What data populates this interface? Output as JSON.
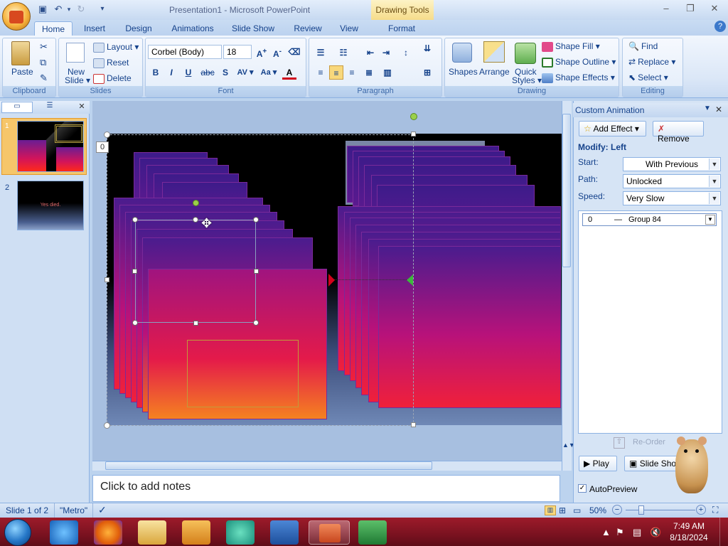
{
  "window": {
    "title": "Presentation1 - Microsoft PowerPoint",
    "context_tab": "Drawing Tools",
    "minimize": "–",
    "restore": "❐",
    "close": "✕"
  },
  "qat": {
    "save_icon": "save-icon",
    "undo_icon": "undo-icon",
    "redo_icon": "redo-icon",
    "customize": "▾"
  },
  "tabs": [
    "Home",
    "Insert",
    "Design",
    "Animations",
    "Slide Show",
    "Review",
    "View",
    "Format"
  ],
  "help": "?",
  "ribbon": {
    "clipboard": {
      "label": "Clipboard",
      "paste": "Paste"
    },
    "slides": {
      "label": "Slides",
      "new_slide_line1": "New",
      "new_slide_line2": "Slide ▾",
      "layout": "Layout ▾",
      "reset": "Reset",
      "delete": "Delete"
    },
    "font": {
      "label": "Font",
      "family": "Corbel (Body)",
      "size": "18",
      "bold": "B",
      "italic": "I",
      "underline": "U",
      "strike": "abc",
      "shadow": "S",
      "spacing": "AV ▾",
      "case": "Aa ▾",
      "color": "A"
    },
    "paragraph": {
      "label": "Paragraph"
    },
    "drawing": {
      "label": "Drawing",
      "shapes": "Shapes",
      "arrange": "Arrange",
      "quick_styles_line1": "Quick",
      "quick_styles_line2": "Styles ▾",
      "shape_fill": "Shape Fill ▾",
      "shape_outline": "Shape Outline ▾",
      "shape_effects": "Shape Effects ▾"
    },
    "editing": {
      "label": "Editing",
      "find": "Find",
      "replace": "Replace ▾",
      "select": "Select ▾"
    }
  },
  "slides_panel": {
    "slide1_number": "1",
    "slide2_number": "2",
    "slide2_text": "Yes died."
  },
  "editor": {
    "anim_tag": "0",
    "notes_placeholder": "Click to add notes"
  },
  "task_pane": {
    "title": "Custom Animation",
    "add_effect": "Add Effect ▾",
    "remove": "Remove",
    "modify": "Modify: Left",
    "start_label": "Start:",
    "start_value": "With Previous",
    "path_label": "Path:",
    "path_value": "Unlocked",
    "speed_label": "Speed:",
    "speed_value": "Very Slow",
    "list_items": [
      {
        "order": "0",
        "name": "Group 84"
      }
    ],
    "reorder": "Re-Order",
    "play": "Play",
    "slide_show": "Slide Show",
    "autopreview": "AutoPreview"
  },
  "status": {
    "slide": "Slide 1 of 2",
    "theme": "\"Metro\"",
    "zoom": "50%"
  },
  "taskbar": {
    "time": "7:49 AM",
    "date": "8/18/2024",
    "apps": [
      "internet-explorer-icon",
      "firefox-icon",
      "file-explorer-icon",
      "media-player-icon",
      "edge-icon",
      "word-icon",
      "powerpoint-icon",
      "excel-icon"
    ]
  }
}
